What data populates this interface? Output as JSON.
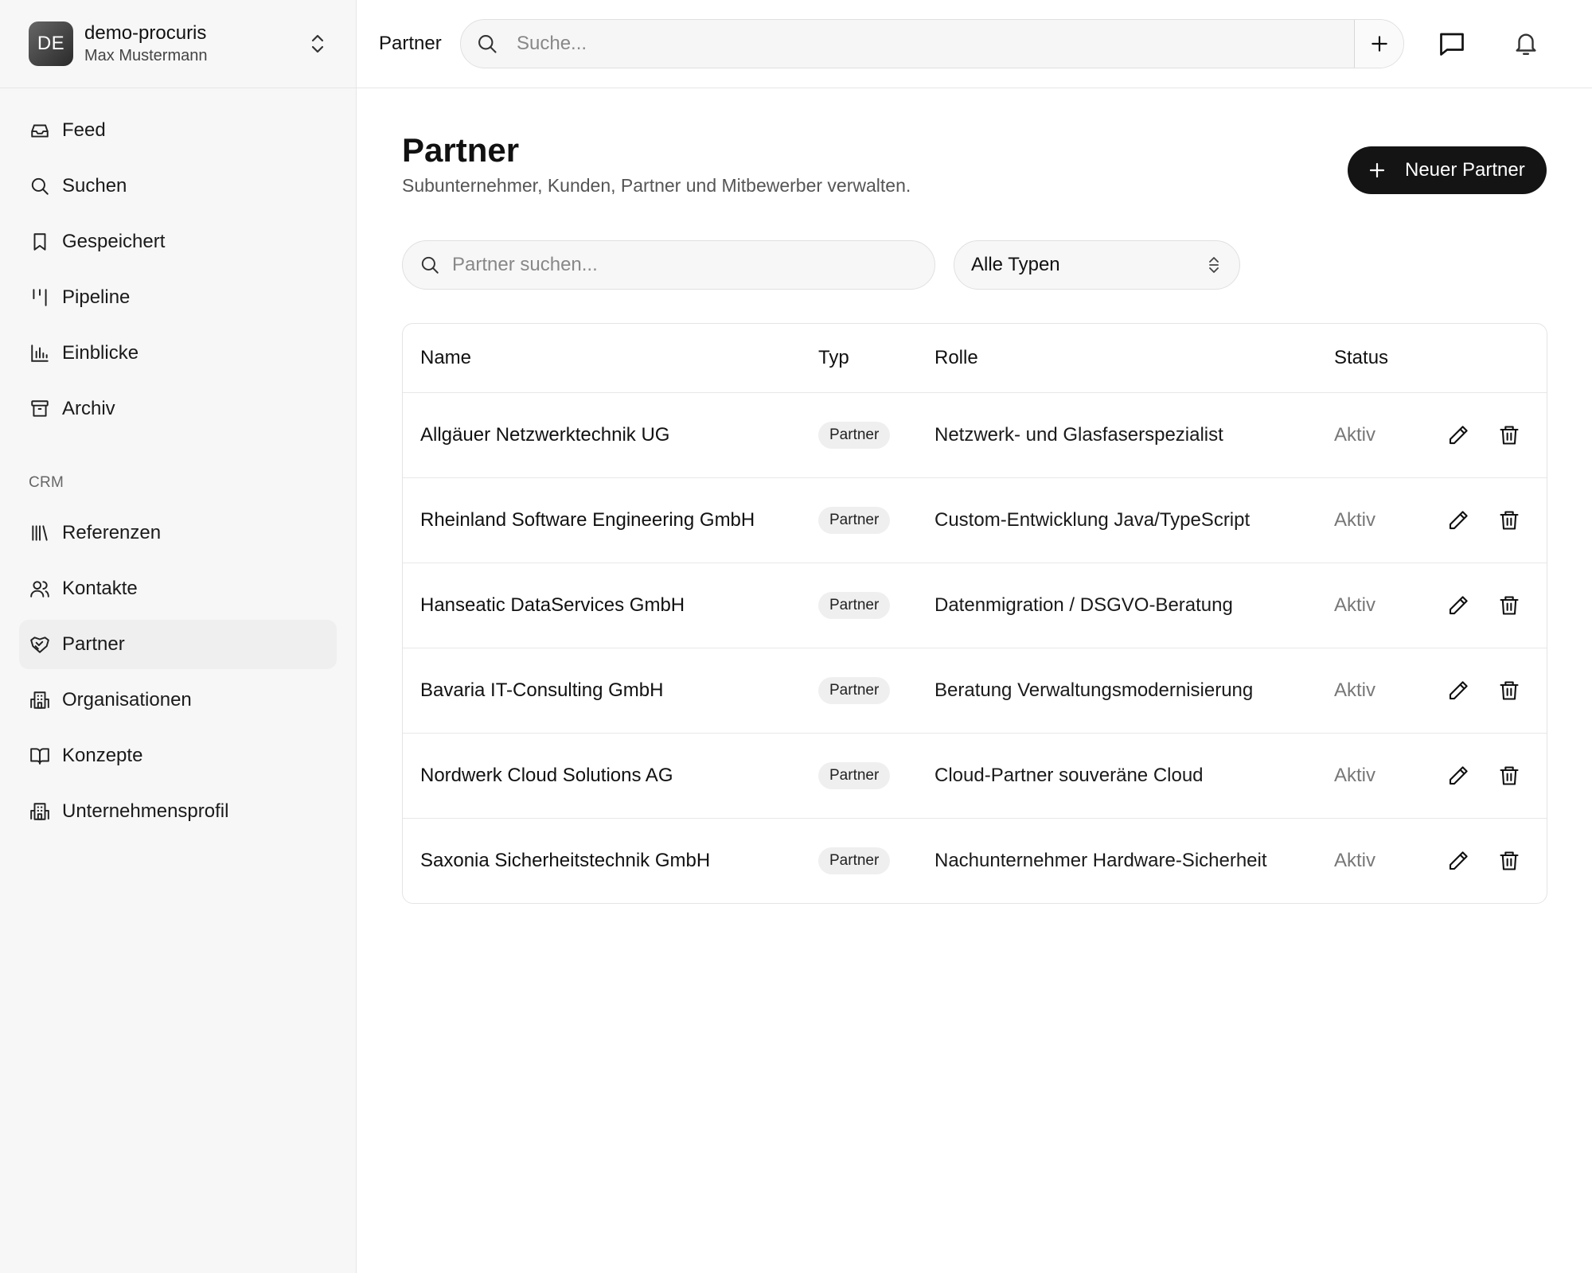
{
  "workspace": {
    "initials": "DE",
    "name": "demo-procuris",
    "user": "Max Mustermann"
  },
  "sidebar": {
    "items": [
      {
        "id": "feed",
        "label": "Feed",
        "icon": "inbox-icon"
      },
      {
        "id": "suchen",
        "label": "Suchen",
        "icon": "search-icon"
      },
      {
        "id": "gespeichert",
        "label": "Gespeichert",
        "icon": "bookmark-icon"
      },
      {
        "id": "pipeline",
        "label": "Pipeline",
        "icon": "kanban-icon"
      },
      {
        "id": "einblicke",
        "label": "Einblicke",
        "icon": "bar-chart-icon"
      },
      {
        "id": "archiv",
        "label": "Archiv",
        "icon": "archive-icon"
      }
    ],
    "crm_section_label": "CRM",
    "crm_items": [
      {
        "id": "referenzen",
        "label": "Referenzen",
        "icon": "library-icon"
      },
      {
        "id": "kontakte",
        "label": "Kontakte",
        "icon": "users-icon"
      },
      {
        "id": "partner",
        "label": "Partner",
        "icon": "handshake-icon",
        "active": true
      },
      {
        "id": "organisationen",
        "label": "Organisationen",
        "icon": "building-icon"
      },
      {
        "id": "konzepte",
        "label": "Konzepte",
        "icon": "book-open-icon"
      },
      {
        "id": "unternehmensprofil",
        "label": "Unternehmensprofil",
        "icon": "building-icon"
      }
    ]
  },
  "topbar": {
    "breadcrumb": "Partner",
    "search_placeholder": "Suche..."
  },
  "page": {
    "title": "Partner",
    "subtitle": "Subunternehmer, Kunden, Partner und Mitbewerber verwalten.",
    "new_button_label": "Neuer Partner"
  },
  "filters": {
    "search_placeholder": "Partner suchen...",
    "type_select_value": "Alle Typen"
  },
  "table": {
    "headers": {
      "name": "Name",
      "typ": "Typ",
      "rolle": "Rolle",
      "status": "Status"
    },
    "rows": [
      {
        "name": "Allgäuer Netzwerktechnik UG",
        "typ": "Partner",
        "rolle": "Netzwerk- und Glasfaserspezialist",
        "status": "Aktiv"
      },
      {
        "name": "Rheinland Software Engineering GmbH",
        "typ": "Partner",
        "rolle": "Custom-Entwicklung Java/TypeScript",
        "status": "Aktiv"
      },
      {
        "name": "Hanseatic DataServices GmbH",
        "typ": "Partner",
        "rolle": "Datenmigration / DSGVO-Beratung",
        "status": "Aktiv"
      },
      {
        "name": "Bavaria IT-Consulting GmbH",
        "typ": "Partner",
        "rolle": "Beratung Verwaltungsmodernisierung",
        "status": "Aktiv"
      },
      {
        "name": "Nordwerk Cloud Solutions AG",
        "typ": "Partner",
        "rolle": "Cloud-Partner souveräne Cloud",
        "status": "Aktiv"
      },
      {
        "name": "Saxonia Sicherheitstechnik GmbH",
        "typ": "Partner",
        "rolle": "Nachunternehmer Hardware-Sicherheit",
        "status": "Aktiv"
      }
    ]
  },
  "colors": {
    "sidebar_bg": "#f7f7f7",
    "primary_button": "#141414",
    "badge_bg": "#efefef",
    "status_text": "#777777"
  }
}
